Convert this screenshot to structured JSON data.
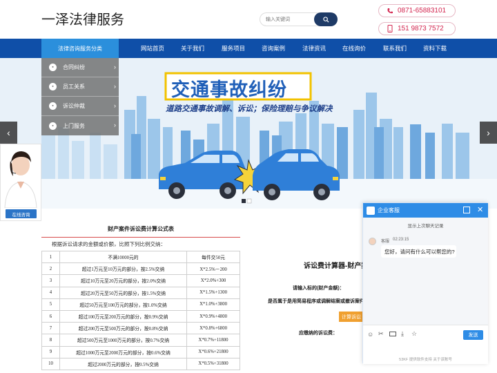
{
  "header": {
    "logo": "一泽法律服务",
    "search_placeholder": "输入关键词",
    "phone1": "0871-65883101",
    "phone2": "151 9873 7572"
  },
  "nav": {
    "category": "法律咨询服务分类",
    "items": [
      "网站首页",
      "关于我们",
      "服务项目",
      "咨询案例",
      "法律资讯",
      "在线询价",
      "联系我们",
      "资料下载"
    ]
  },
  "sidemenu": [
    "合同纠纷",
    "员工关系",
    "诉讼仲裁",
    "上门服务"
  ],
  "banner": {
    "title": "交通事故纠纷",
    "subtitle": "道路交通事故调解、诉讼；保险理赔与争议解决"
  },
  "consult": {
    "button": "在线咨询"
  },
  "fee_table": {
    "title": "财产案件诉讼费计算公式表",
    "desc": "根据诉讼请求的金额或价额，比照下列比例交纳：",
    "rows": [
      [
        "1",
        "不满10000元的",
        "每件交50元"
      ],
      [
        "2",
        "超过1万元至10万元的部分，按2.5%交纳",
        "X*2.5%－200"
      ],
      [
        "3",
        "超过10万元至20万元的部分，按2.0%交纳",
        "X*2.0%+300"
      ],
      [
        "4",
        "超过20万元至50万元的部分，按1.5%交纳",
        "X*1.5%+1300"
      ],
      [
        "5",
        "超过50万元至100万元的部分，按1.0%交纳",
        "X*1.0%+3800"
      ],
      [
        "6",
        "超过100万元至200万元的部分，按0.9%交纳",
        "X*0.9%+4800"
      ],
      [
        "7",
        "超过200万元至500万元的部分，按0.8%交纳",
        "X*0.8%+6800"
      ],
      [
        "8",
        "超过500万元至1000万元的部分，按0.7%交纳",
        "X*0.7%+11800"
      ],
      [
        "9",
        "超过1000万元至2000万元的部分，按0.6%交纳",
        "X*0.6%+21800"
      ],
      [
        "10",
        "超过2000万元的部分，按0.5%交纳",
        "X*0.5%+31800"
      ]
    ]
  },
  "calculator": {
    "title": "诉讼费计算器-财产案",
    "amount_label": "请输入标的(财产金额)：",
    "procedure_label": "是否属于是用简易程序或调解结案或撤诉案件",
    "button": "计算诉讼",
    "result_label": "应缴纳的诉讼费："
  },
  "chat": {
    "title": "企业客服",
    "history": "显示上次聊天记录",
    "agent": "客服",
    "time": "02:23:15",
    "message": "您好，请问有什么可以帮您的?",
    "send": "发送",
    "footer": "53KF 提供软件支持  关于该账号"
  }
}
